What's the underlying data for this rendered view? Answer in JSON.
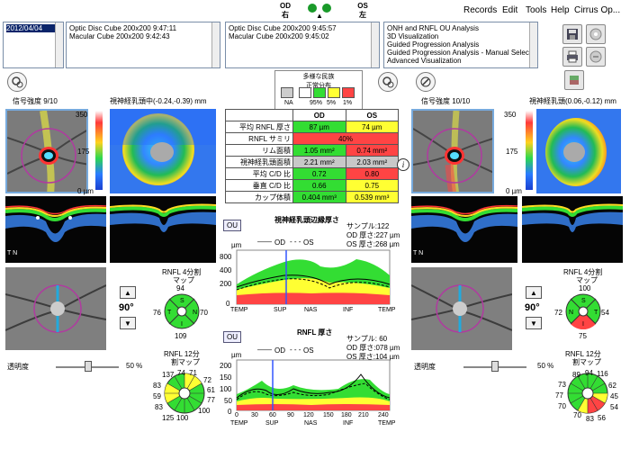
{
  "menubar": {
    "items": [
      "Records",
      "Edit",
      "Tools",
      "Help",
      "Cirrus Op..."
    ]
  },
  "eyes": {
    "od_label": "OD",
    "od_sub": "右",
    "os_label": "OS",
    "os_sub": "左",
    "indicator": "▲"
  },
  "lists": {
    "date": [
      "2012/04/04"
    ],
    "od_scans": [
      "Optic Disc Cube 200x200    9:47:11",
      "Macular Cube 200x200    9:42:43"
    ],
    "os_scans": [
      "Optic Disc Cube 200x200    9:45:57",
      "Macular Cube 200x200    9:45:02"
    ],
    "analyses": [
      "ONH and RNFL OU Analysis",
      "3D Visualization",
      "Guided Progression Analysis",
      "Guided Progression Analysis - Manual Selection",
      "Advanced Visualization"
    ]
  },
  "legend": {
    "title1": "多様な民族",
    "title2": "正常分布",
    "labels": [
      "NA",
      "95%",
      "5%",
      "1%"
    ]
  },
  "od": {
    "signal": "信号強度  9/10",
    "thickness_title": "視神経乳頭中(-0.24,-0.39) mm",
    "scale": [
      "350",
      "175",
      "0 µm"
    ],
    "quad_title": "RNFL 4分割",
    "quad_sub": "マップ",
    "quad": {
      "S": "94",
      "T": "76",
      "N": "70",
      "I": "109"
    },
    "angle": "90°",
    "clock_title": "RNFL 12分",
    "clock_sub": "割マップ",
    "clock": [
      "74",
      "71",
      "72",
      "61",
      "77",
      "100",
      "100",
      "125",
      "83",
      "59",
      "83",
      "137"
    ],
    "opacity": "透明度",
    "opacity_val": "50 %"
  },
  "os": {
    "signal": "信号強度  10/10",
    "thickness_title": "視神経乳頭(0.06,-0.12) mm",
    "scale": [
      "350",
      "175",
      "0 µm"
    ],
    "quad_title": "RNFL 4分割",
    "quad_sub": "マップ",
    "quad": {
      "S": "100",
      "T": "72",
      "N": "54",
      "I": "75"
    },
    "angle": "90°",
    "clock_title": "RNFL 12分",
    "clock_sub": "割マップ",
    "clock": [
      "94",
      "116",
      "62",
      "45",
      "54",
      "56",
      "83",
      "70",
      "70",
      "77",
      "73",
      "89"
    ],
    "opacity": "透明度",
    "opacity_val": "50 %"
  },
  "metrics": {
    "col_od": "OD",
    "col_os": "OS",
    "rows": [
      {
        "label": "平均 RNFL 厚さ",
        "od": "87 µm",
        "os": "74 µm",
        "od_c": "g",
        "os_c": "y"
      },
      {
        "label": "RNFL サミリ",
        "span": "40%",
        "span_c": "r"
      },
      {
        "label": "リム面積",
        "od": "1.05 mm²",
        "os": "0.74 mm²",
        "od_c": "g",
        "os_c": "r"
      },
      {
        "label": "視神経乳頭面積",
        "od": "2.21 mm²",
        "os": "2.03 mm²",
        "od_c": "gr",
        "os_c": "gr"
      },
      {
        "label": "平均 C/D 比",
        "od": "0.72",
        "os": "0.80",
        "od_c": "g",
        "os_c": "r"
      },
      {
        "label": "垂直 C/D 比",
        "od": "0.66",
        "os": "0.75",
        "od_c": "g",
        "os_c": "y"
      },
      {
        "label": "カップ体積",
        "od": "0.404 mm³",
        "os": "0.539 mm³",
        "od_c": "g",
        "os_c": "y"
      }
    ]
  },
  "graph1": {
    "title": "視神経乳頭辺縁厚さ",
    "ou": "OU",
    "unit": "µm",
    "legend_od": "OD",
    "legend_os": "OS",
    "samples": "サンプル:122",
    "od_info": "OD 厚さ:227 µm",
    "os_info": "OS 厚さ:268 µm",
    "yticks": [
      "800",
      "400",
      "200",
      "0"
    ],
    "xticks": [
      "TEMP",
      "SUP",
      "NAS",
      "INF",
      "TEMP"
    ]
  },
  "graph2": {
    "title": "RNFL 厚さ",
    "ou": "OU",
    "unit": "µm",
    "legend_od": "OD",
    "legend_os": "OS",
    "samples": "サンプル: 60",
    "od_info": "OD 厚さ:078 µm",
    "os_info": "OS 厚さ:104 µm",
    "yticks": [
      "200",
      "150",
      "100",
      "50",
      "0"
    ],
    "xnums": [
      "0",
      "30",
      "60",
      "90",
      "120",
      "150",
      "180",
      "210",
      "240"
    ],
    "xticks": [
      "TEMP",
      "SUP",
      "NAS",
      "INF",
      "TEMP"
    ]
  },
  "colors": {
    "green": "#33dd33",
    "yellow": "#ffff33",
    "red": "#ff4444",
    "blue": "#3355ff"
  }
}
